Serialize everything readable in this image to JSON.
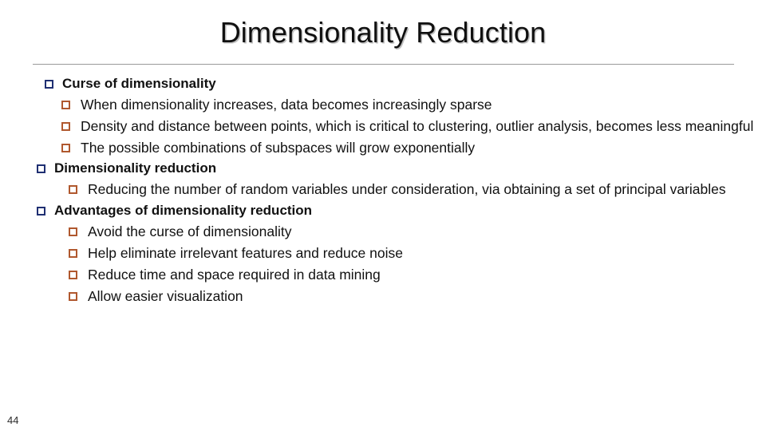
{
  "slide": {
    "title": "Dimensionality Reduction",
    "page_number": "44",
    "colors": {
      "bullet_level1": "#1f2f72",
      "bullet_level2": "#b0582e",
      "text": "#111111",
      "rule": "#9a9a9a",
      "background": "#ffffff"
    },
    "bullet_icon_level1": "hollow-square-navy",
    "bullet_icon_level2": "hollow-square-brown",
    "content": [
      {
        "level": 1,
        "bold": true,
        "text": "Curse of dimensionality",
        "children": [
          {
            "level": 2,
            "bold": false,
            "text": "When dimensionality increases, data becomes increasingly sparse"
          },
          {
            "level": 2,
            "bold": false,
            "text": "Density and distance between points, which is critical to clustering, outlier analysis, becomes less meaningful"
          },
          {
            "level": 2,
            "bold": false,
            "text": "The possible combinations of subspaces will grow exponentially"
          }
        ]
      },
      {
        "level": 1,
        "bold": true,
        "text": "Dimensionality reduction",
        "children": [
          {
            "level": 2,
            "bold": false,
            "text": "Reducing the number of random variables under consideration, via obtaining a set of principal variables"
          }
        ]
      },
      {
        "level": 1,
        "bold": true,
        "text": "Advantages of dimensionality reduction",
        "children": [
          {
            "level": 2,
            "bold": false,
            "text": "Avoid the curse of dimensionality"
          },
          {
            "level": 2,
            "bold": false,
            "text": "Help eliminate irrelevant features and reduce noise"
          },
          {
            "level": 2,
            "bold": false,
            "text": "Reduce time and space required in data mining"
          },
          {
            "level": 2,
            "bold": false,
            "text": "Allow easier visualization"
          }
        ]
      }
    ]
  }
}
